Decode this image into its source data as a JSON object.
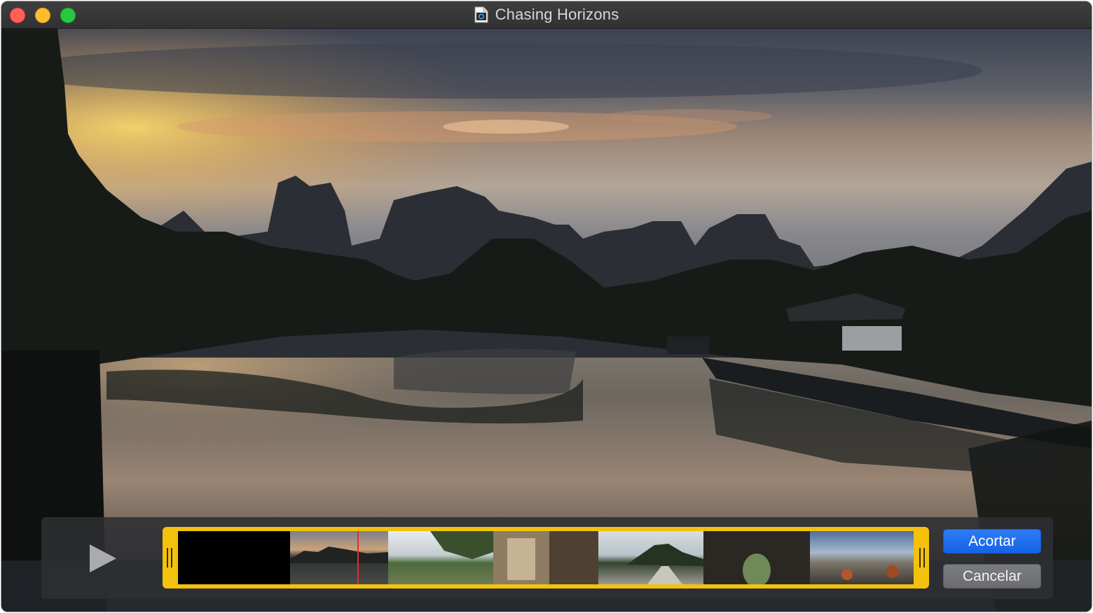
{
  "window": {
    "title": "Chasing Horizons",
    "title_icon": "quicktime-document-icon"
  },
  "trim_controls": {
    "play_icon": "play-icon",
    "trim_button_label": "Acortar",
    "cancel_button_label": "Cancelar",
    "trim_handle_color": "#f4c20d",
    "playhead_color": "#e0302c",
    "filmstrip_thumbnail_count": 7
  },
  "colors": {
    "primary_button": "#1a6cf0",
    "secondary_button": "#737476"
  }
}
